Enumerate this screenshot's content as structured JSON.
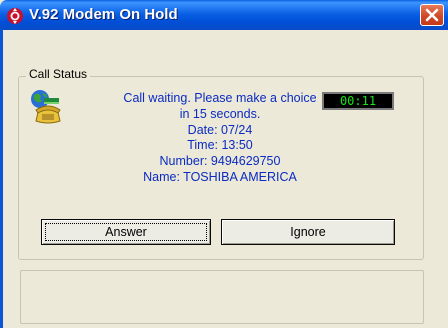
{
  "window": {
    "title": "V.92 Modem On Hold",
    "app_icon": "modem-app-icon",
    "close_icon": "close-icon",
    "accent_color": "#0b61e4",
    "close_color": "#d14a28"
  },
  "call_status": {
    "group_label": "Call Status",
    "icon": "globe-phone-icon",
    "message_line1": "Call waiting.  Please make a choice",
    "message_line2": "in  15 seconds.",
    "date": "Date: 07/24",
    "time": "Time: 13:50",
    "number": "Number: 9494629750",
    "name": "Name: TOSHIBA AMERICA",
    "timer": "00:11",
    "text_color": "#0b2bc2",
    "timer_color": "#18e418"
  },
  "buttons": {
    "answer": "Answer",
    "ignore": "Ignore"
  },
  "status_bar": {
    "text": ""
  }
}
